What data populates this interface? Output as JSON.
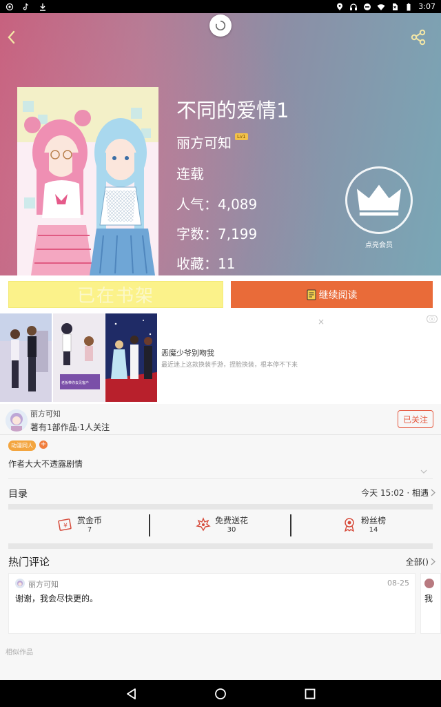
{
  "status_bar": {
    "time": "3:07",
    "left_icons": [
      "netease-music-icon",
      "tiktok-icon",
      "download-icon"
    ],
    "right_icons": [
      "location-icon",
      "headset-icon",
      "do-not-disturb-icon",
      "wifi-icon",
      "no-sim-icon",
      "battery-icon"
    ]
  },
  "book": {
    "title": "不同的爱情1",
    "author": "丽方可知",
    "level_badge": "Lv1",
    "status": "连载",
    "stats": [
      {
        "label": "人气：",
        "value": "4,089"
      },
      {
        "label": "字数：",
        "value": "7,199"
      },
      {
        "label": "收藏：",
        "value": "11"
      }
    ],
    "vip_label": "点亮会员"
  },
  "actions": {
    "shelf_label": "已在书架",
    "read_label": "继续阅读"
  },
  "ad": {
    "title": "恶魔少爷别吻我",
    "description": "最近迷上这款换装手游，捏脸换装，根本停不下来",
    "close": "×",
    "badge": "ⓧ",
    "image2_caption": "老板带你去见客户"
  },
  "author_section": {
    "name": "丽方可知",
    "meta": "著有1部作品·1人关注",
    "follow_label": "已关注",
    "tag": "动漫同人",
    "tag_add": "+",
    "description": "作者大大不透露剧情"
  },
  "toc": {
    "label": "目录",
    "update": "今天 15:02 · 相遇"
  },
  "stats_row": [
    {
      "label": "赏金币",
      "value": "7",
      "icon": "coin-envelope-icon"
    },
    {
      "label": "免费送花",
      "value": "30",
      "icon": "flower-icon"
    },
    {
      "label": "粉丝榜",
      "value": "14",
      "icon": "medal-icon"
    }
  ],
  "comments": {
    "label": "热门评论",
    "all_label": "全部()",
    "items": [
      {
        "name": "丽方可知",
        "date": "08-25",
        "text": "谢谢，我会尽快更的。"
      },
      {
        "text": "我"
      }
    ]
  },
  "similar_label": "相似作品",
  "colors": {
    "accent_orange": "#e96b39",
    "shelf_yellow": "#fbf28a",
    "follow_red": "#e5583f"
  }
}
